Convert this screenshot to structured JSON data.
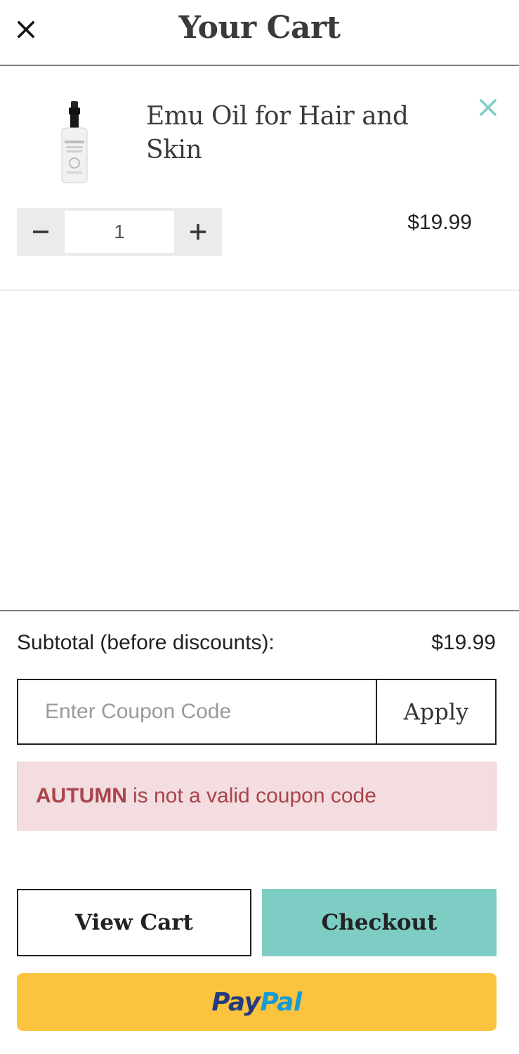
{
  "header": {
    "title": "Your Cart",
    "close_icon": "close-icon"
  },
  "cart": {
    "items": [
      {
        "name": "Emu Oil for Hair and Skin",
        "thumbnail_icon": "spray-bottle-image",
        "quantity": "1",
        "price": "$19.99",
        "decrease_icon": "minus-icon",
        "increase_icon": "plus-icon",
        "remove_icon": "close-icon"
      }
    ]
  },
  "summary": {
    "subtotal_label": "Subtotal (before discounts):",
    "subtotal_value": "$19.99"
  },
  "coupon": {
    "placeholder": "Enter Coupon Code",
    "value": "",
    "apply_label": "Apply"
  },
  "alert": {
    "code": "AUTUMN",
    "message": "is not a valid coupon code"
  },
  "actions": {
    "view_cart_label": "View Cart",
    "checkout_label": "Checkout",
    "paypal_part1": "Pay",
    "paypal_part2": "Pal"
  },
  "colors": {
    "checkout_bg": "#7ecdc4",
    "paypal_bg": "#fcc43e",
    "alert_bg": "#f3dde0",
    "alert_text": "#a9444a",
    "remove_icon": "#7ecdc4",
    "paypal_dark": "#253b80",
    "paypal_light": "#179bd7"
  }
}
